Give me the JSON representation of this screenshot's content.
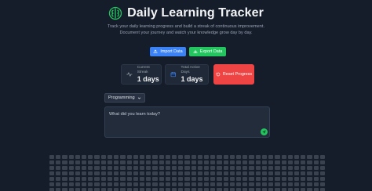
{
  "app": {
    "title": "Daily Learning Tracker",
    "subtitle": "Track your daily learning progress and build a streak of continuous improvement. Document your journey and watch your knowledge grow day by day."
  },
  "actions": {
    "import_label": "Import Data",
    "export_label": "Export Data",
    "reset_label": "Reset Progress"
  },
  "stats": {
    "current_streak": {
      "label": "Current Streak",
      "value": "1 days"
    },
    "total_active": {
      "label": "Total Active Days",
      "value": "1 days"
    }
  },
  "entry": {
    "category_selected": "Programming",
    "placeholder": "What did you learn today?"
  },
  "icons": {
    "logo": "brain-icon",
    "import": "upload-icon",
    "export": "download-icon",
    "streak": "activity-icon",
    "calendar": "calendar-icon",
    "reset": "refresh-icon",
    "submit": "send-icon"
  },
  "colors": {
    "background": "#151d2a",
    "accent_blue": "#3b82f6",
    "accent_green": "#22c55e",
    "danger": "#ef4444",
    "logo": "#22c55e"
  },
  "activity_grid": {
    "rows": 7,
    "columns": 43,
    "active_cells": 0
  }
}
